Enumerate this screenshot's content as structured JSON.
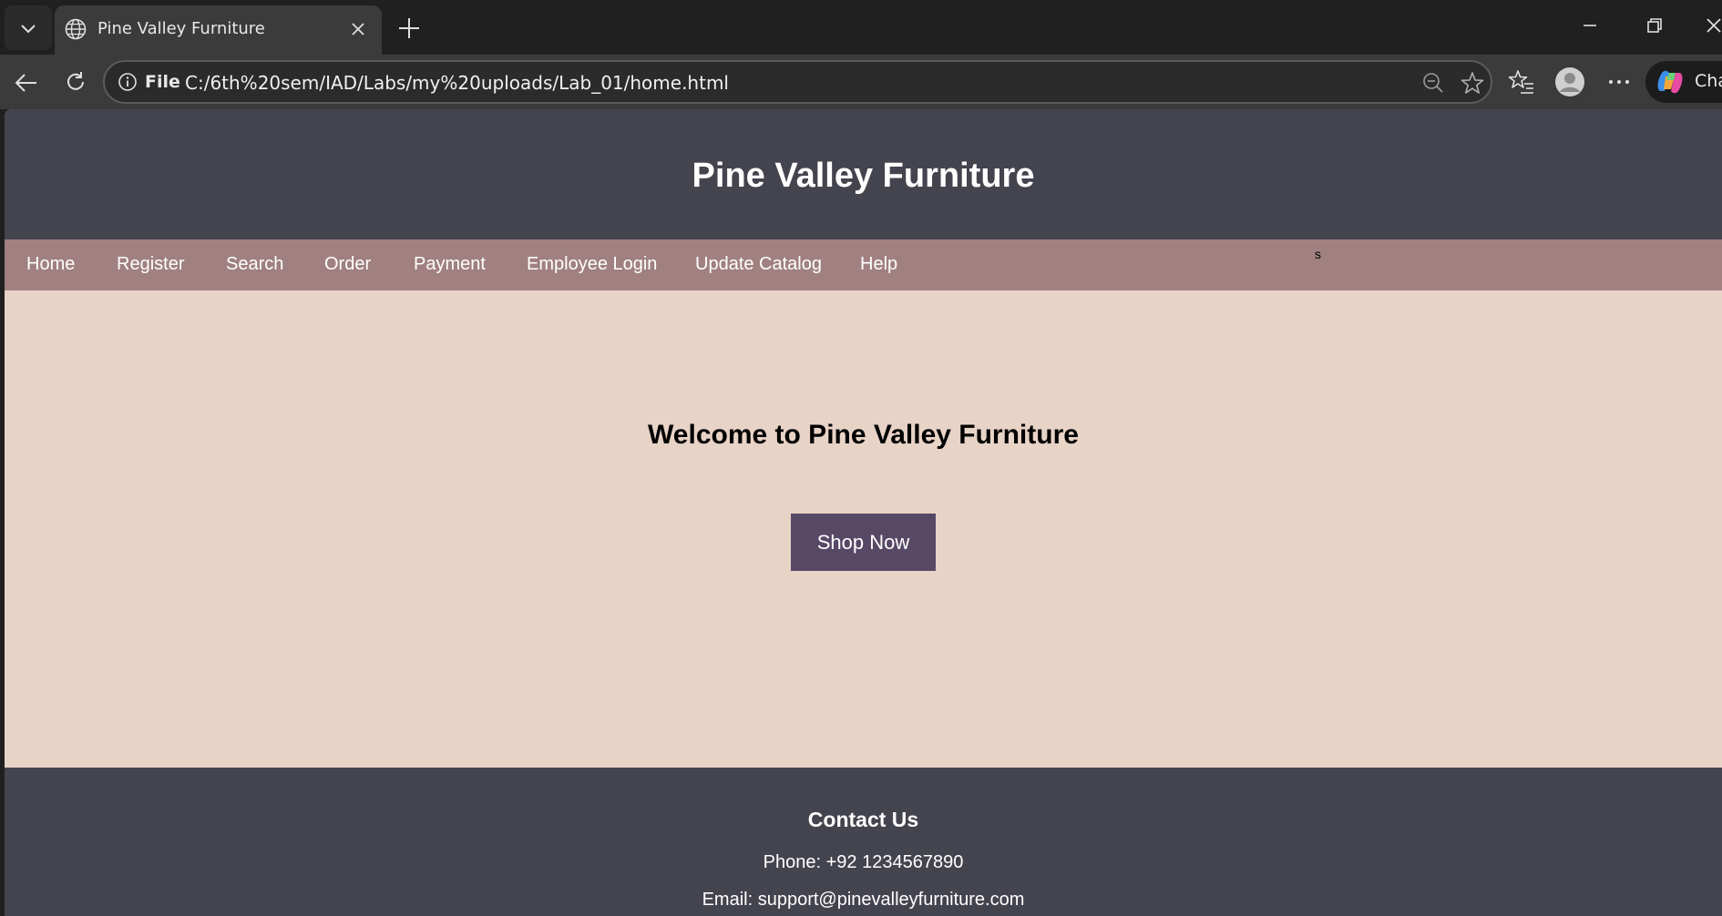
{
  "browser": {
    "tab_title": "Pine Valley Furniture",
    "address_scheme": "File",
    "address_url": "C:/6th%20sem/IAD/Labs/my%20uploads/Lab_01/home.html",
    "copilot_label": "Cha"
  },
  "page": {
    "site_title": "Pine Valley Furniture",
    "nav": [
      "Home",
      "Register",
      "Search",
      "Order",
      "Payment",
      "Employee Login",
      "Update Catalog",
      "Help"
    ],
    "stray_text": "s",
    "hero_title": "Welcome to Pine Valley Furniture",
    "shop_button": "Shop Now",
    "footer": {
      "heading": "Contact Us",
      "phone": "Phone: +92 1234567890",
      "email": "Email: support@pinevalleyfurniture.com"
    }
  },
  "colors": {
    "header_bg": "#44444f",
    "nav_bg": "#a08080",
    "body_bg": "#e8d3c7",
    "button_bg": "#574966"
  }
}
